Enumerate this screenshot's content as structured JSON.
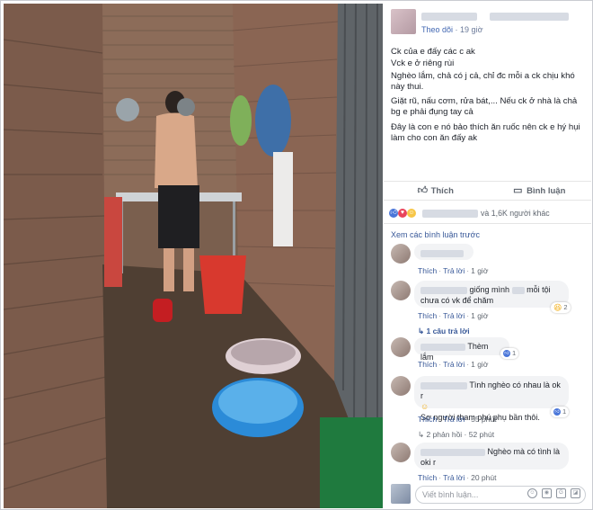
{
  "post": {
    "follow_label": "Theo dõi",
    "time": "19 giờ",
    "lines": [
      "Ck của e đấy các c ak",
      "Vck e ở riêng rùi",
      "Nghèo lắm, chả có j cả, chỉ đc mỗi a ck chịu khó này thui.",
      "Giặt rũ, nấu cơm, rửa bát,... Nếu ck ở nhà là chả bg e phải đụng tay cả",
      "Đây là con e nó bảo thích ăn ruốc nên ck e hý hụi làm cho con ăn đấy ak"
    ]
  },
  "actions": {
    "like_label": "Thích",
    "comment_label": "Bình luận"
  },
  "reactions": {
    "summary": "và 1,6K người khác"
  },
  "comments_header": "Xem các bình luận trước",
  "comments": [
    {
      "text": "",
      "like": "Thích",
      "reply": "Trả lời",
      "time": "1 giờ",
      "badge": ""
    },
    {
      "text_a": "giống mình",
      "text_b": "mỗi tội chưa có vk để chăm",
      "like": "Thích",
      "reply": "Trả lời",
      "time": "1 giờ",
      "badge": "2",
      "replies": "1 câu trả lời"
    },
    {
      "text": "Thèm lắm",
      "like": "Thích",
      "reply": "Trả lời",
      "time": "1 giờ",
      "badge": "1"
    },
    {
      "text_a": "Tình nghèo có nhau là ok r",
      "text_b": "Sợ người tham phú phụ bần thôi.",
      "like": "Thích",
      "reply": "Trả lời",
      "time": "55 phút",
      "badge": "1",
      "replies": "2 phản hồi · 52 phút"
    },
    {
      "text_a": "Nghèo mà có tình là",
      "text_b": "oki r",
      "like": "Thích",
      "reply": "Trả lời",
      "time": "20 phút",
      "badge": ""
    }
  ],
  "composer": {
    "placeholder": "Viết bình luận..."
  },
  "icons": [
    "like-icon",
    "comment-icon",
    "camera-icon",
    "gif-icon",
    "sticker-icon",
    "emoji-icon"
  ]
}
